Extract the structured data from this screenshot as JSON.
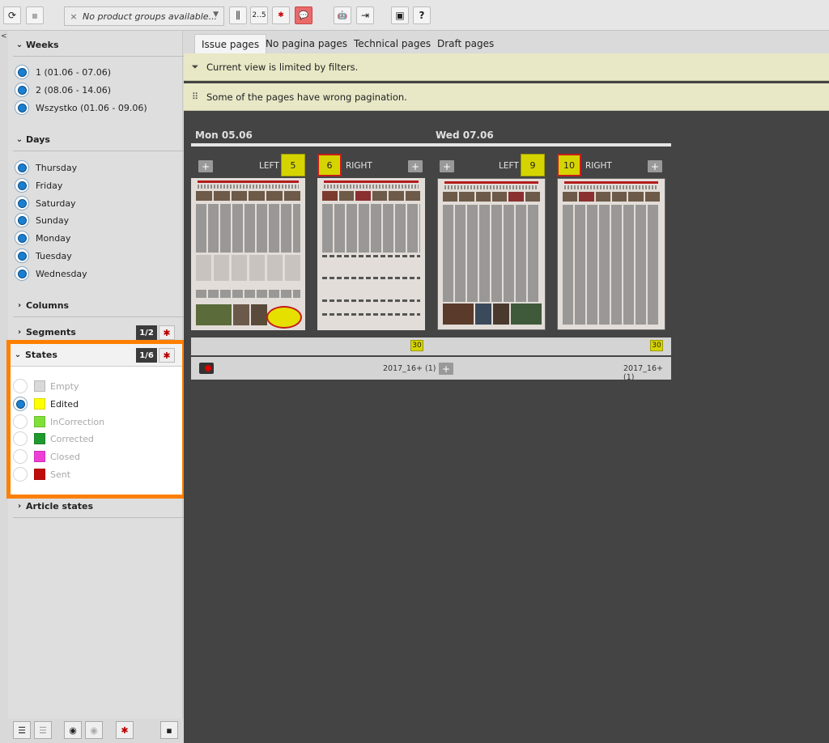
{
  "toolbar": {
    "product_groups_placeholder": "No product groups available...",
    "clear_glyph": "×",
    "caret_glyph": "▼",
    "pagination_label": "2..5",
    "icons": {
      "refresh": "⟳",
      "save": "▪",
      "columns": "⫼",
      "filter": "✱",
      "comment": "💬",
      "android": "🤖",
      "logout": "⇥",
      "window": "▣",
      "help": "?"
    }
  },
  "sidebar": {
    "collapse_glyph": "<",
    "weeks": {
      "title": "Weeks",
      "items": [
        {
          "label": "1 (01.06 - 07.06)",
          "selected": true
        },
        {
          "label": "2 (08.06 - 14.06)",
          "selected": true
        },
        {
          "label": "Wszystko (01.06 - 09.06)",
          "selected": true
        }
      ]
    },
    "days": {
      "title": "Days",
      "items": [
        {
          "label": "Thursday",
          "selected": true
        },
        {
          "label": "Friday",
          "selected": true
        },
        {
          "label": "Saturday",
          "selected": true
        },
        {
          "label": "Sunday",
          "selected": true
        },
        {
          "label": "Monday",
          "selected": true
        },
        {
          "label": "Tuesday",
          "selected": true
        },
        {
          "label": "Wednesday",
          "selected": true
        }
      ]
    },
    "columns": {
      "title": "Columns"
    },
    "segments": {
      "title": "Segments",
      "count": "1/2"
    },
    "states": {
      "title": "States",
      "count": "1/6",
      "items": [
        {
          "label": "Empty",
          "color": "#d9d9d9",
          "selected": false
        },
        {
          "label": "Edited",
          "color": "#ffff00",
          "selected": true
        },
        {
          "label": "InCorrection",
          "color": "#7fe03a",
          "selected": false
        },
        {
          "label": "Corrected",
          "color": "#1f9a2e",
          "selected": false
        },
        {
          "label": "Closed",
          "color": "#ee3ed6",
          "selected": false
        },
        {
          "label": "Sent",
          "color": "#c10c0c",
          "selected": false
        }
      ]
    },
    "article_states": {
      "title": "Article states"
    },
    "clear_glyph": "✱"
  },
  "main": {
    "tabs": [
      {
        "label": "Issue pages",
        "active": true
      },
      {
        "label": "No pagina pages",
        "active": false
      },
      {
        "label": "Technical pages",
        "active": false
      },
      {
        "label": "Draft pages",
        "active": false
      }
    ],
    "filter_banner": "Current view is limited by filters.",
    "pagination_banner": "Some of the pages have wrong pagination.",
    "days": [
      {
        "label": "Mon 05.06"
      },
      {
        "label": "Wed 07.06"
      }
    ],
    "spreads": [
      {
        "left": {
          "side": "LEFT",
          "number": "5"
        },
        "right": {
          "side": "RIGHT",
          "number": "6"
        },
        "count": "30",
        "source": "2017_16+ (1)"
      },
      {
        "left": {
          "side": "LEFT",
          "number": "9"
        },
        "right": {
          "side": "RIGHT",
          "number": "10"
        },
        "count": "30",
        "source": "2017_16+ (1)"
      }
    ],
    "add_glyph": "+"
  }
}
